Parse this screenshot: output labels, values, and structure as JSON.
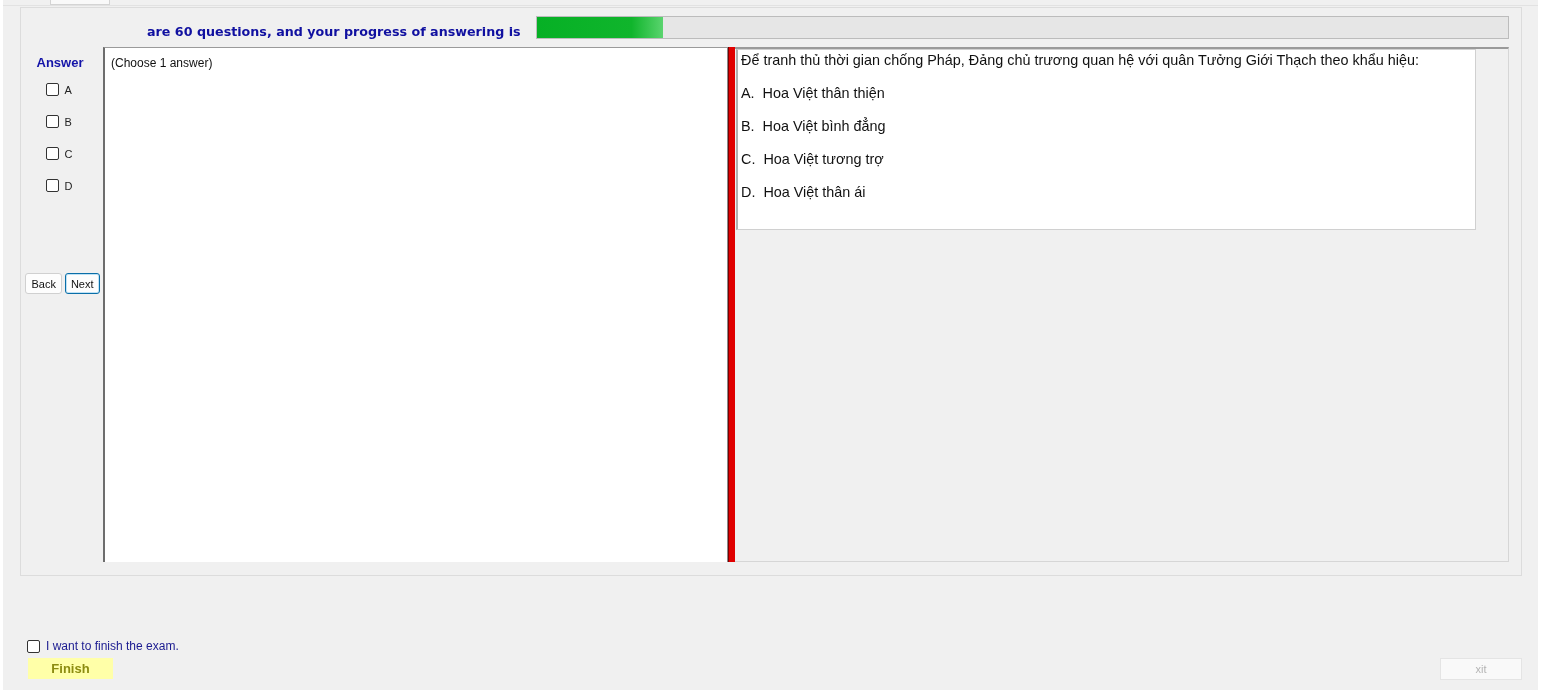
{
  "header": {
    "progress_text": "are 60 questions, and your progress of answering is",
    "progress": {
      "level": 0.13
    }
  },
  "answer_panel": {
    "title": "Answer",
    "options": [
      {
        "label": "A",
        "checked": false
      },
      {
        "label": "B",
        "checked": false
      },
      {
        "label": "C",
        "checked": false
      },
      {
        "label": "D",
        "checked": false
      }
    ],
    "buttons": [
      {
        "label": "Back",
        "focused": false
      },
      {
        "label": "Next",
        "focused": true
      }
    ]
  },
  "answer_box": {
    "text": "(Choose 1 answer)"
  },
  "question": {
    "text": "Để tranh thủ thời gian chống Pháp, Đảng chủ trương quan hệ với quân Tưởng Giới Thạch theo khẩu hiệu:",
    "options": [
      "A.  Hoa Việt thân thiện",
      "B.  Hoa Việt bình đẳng",
      "C.  Hoa Việt tương trợ",
      "D.  Hoa Việt thân ái"
    ]
  },
  "footer": {
    "finish_confirm": {
      "label": "I want to finish the exam.",
      "checked": false
    },
    "finish_button": {
      "label": "Finish"
    },
    "exit_button": {
      "label": "xit",
      "disabled": true
    }
  }
}
